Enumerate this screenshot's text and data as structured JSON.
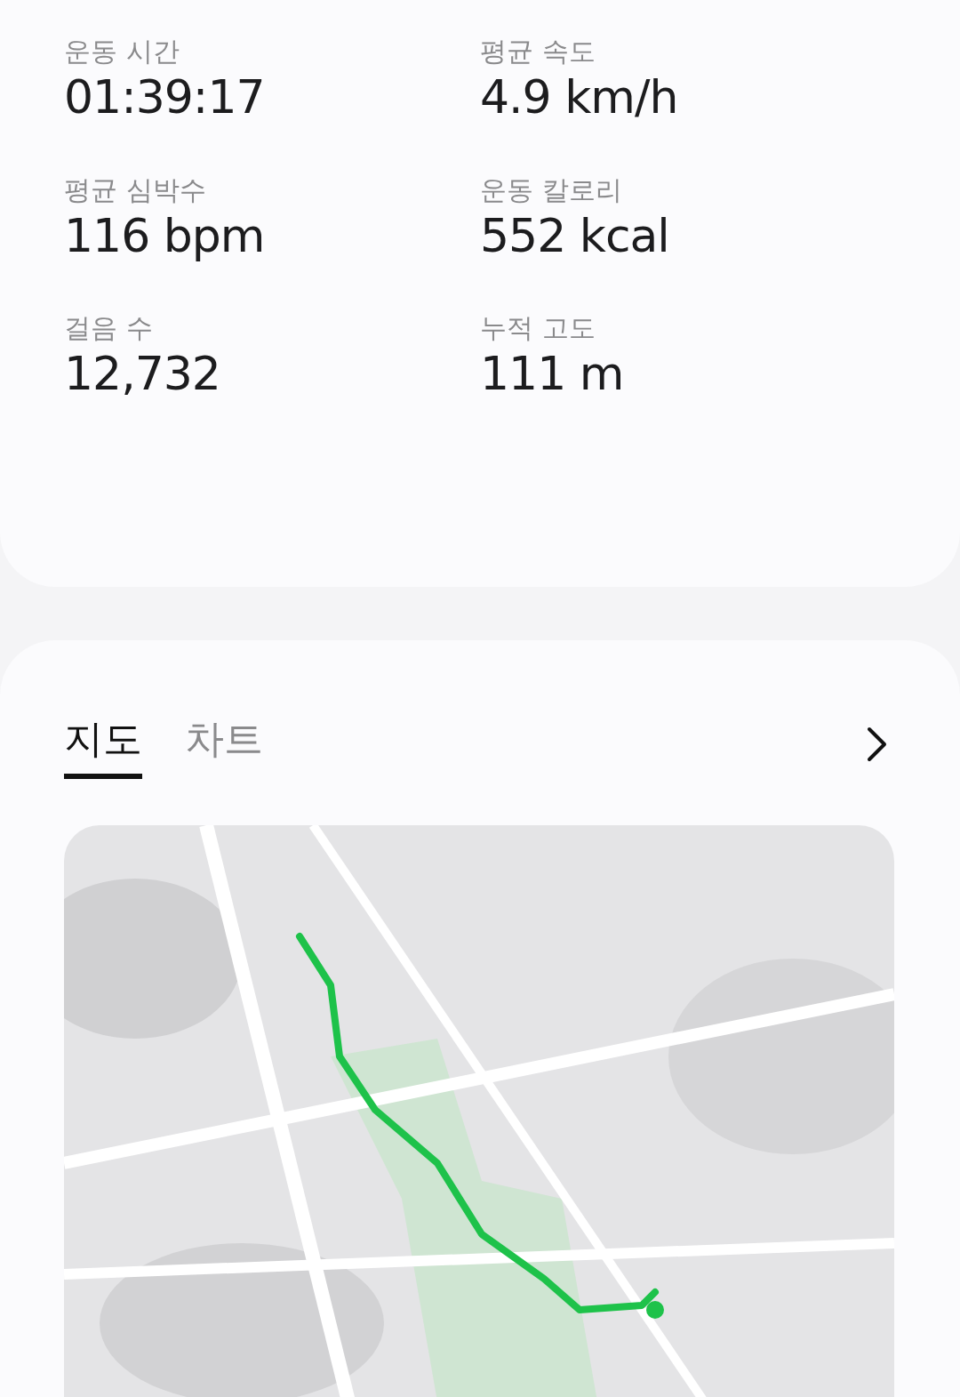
{
  "stats": [
    {
      "label": "운동 시간",
      "value": "01:39:17"
    },
    {
      "label": "평균 속도",
      "value": "4.9 km/h"
    },
    {
      "label": "평균 심박수",
      "value": "116 bpm"
    },
    {
      "label": "운동 칼로리",
      "value": "552 kcal"
    },
    {
      "label": "걸음 수",
      "value": "12,732"
    },
    {
      "label": "누적 고도",
      "value": "111 m"
    }
  ],
  "tabs": [
    {
      "label": "지도",
      "selected": true
    },
    {
      "label": "차트",
      "selected": false
    }
  ]
}
